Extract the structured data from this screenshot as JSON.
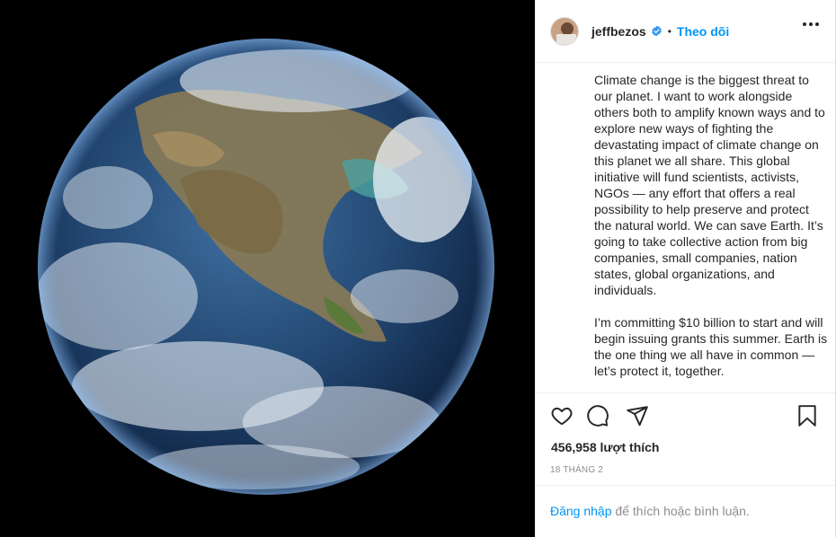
{
  "header": {
    "username": "jeffbezos",
    "separator": "•",
    "follow_label": "Theo dõi"
  },
  "caption": {
    "paragraph1": "Climate change is the biggest threat to our planet. I want to work alongside others both to amplify known ways and to explore new ways of fighting the devastating impact of climate change on this planet we all share. This global initiative will fund scientists, activists, NGOs — any effort that offers a real possibility to help preserve and protect the natural world. We can save Earth. It’s going to take collective action from big companies, small companies, nation states, global organizations, and individuals.",
    "paragraph2": "I’m committing $10 billion to start and will begin issuing grants this summer. Earth is the one thing we all have in common — let’s protect it, together."
  },
  "stats": {
    "likes": "456,958 lượt thích",
    "date": "18 THÁNG 2"
  },
  "footer": {
    "login_link": "Đăng nhập",
    "login_text": " để thích hoặc bình luận."
  },
  "icons": {
    "like": "heart-icon",
    "comment": "comment-icon",
    "share": "share-icon",
    "save": "bookmark-icon",
    "more": "more-options-icon",
    "verified": "verified-badge-icon"
  },
  "colors": {
    "accent": "#0095f6",
    "muted": "#8e8e8e",
    "text": "#262626"
  }
}
